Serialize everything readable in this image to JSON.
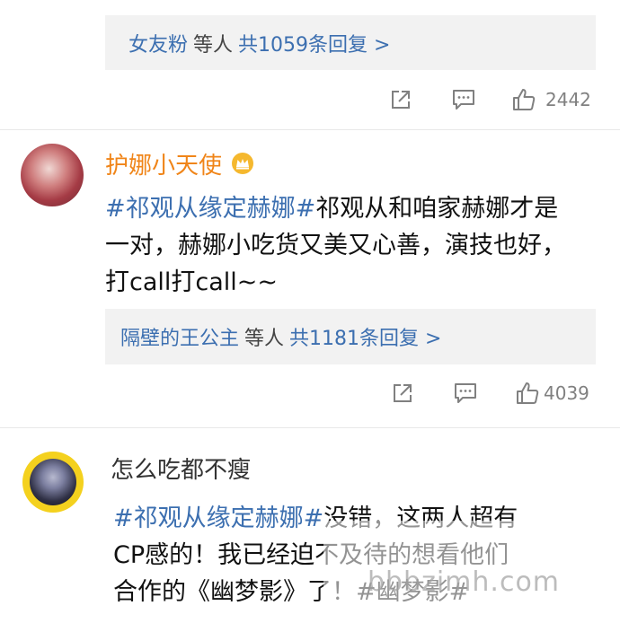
{
  "comment1": {
    "reply_summary": {
      "names": "女友粉",
      "suffix": "等人",
      "count_link": "共1059条回复 >"
    },
    "actions": {
      "like_count": "2442"
    }
  },
  "comment2": {
    "username": "护娜小天使",
    "hashtag": "#祁观从缘定赫娜#",
    "text": "祁观从和咱家赫娜才是一对，赫娜小吃货又美又心善，演技也好，打call打call~~",
    "reply_summary": {
      "names": "隔壁的王公主",
      "suffix": "等人",
      "count_link": "共1181条回复 >"
    },
    "actions": {
      "like_count": "4039"
    }
  },
  "comment3": {
    "username": "怎么吃都不瘦",
    "hashtag": "#祁观从缘定赫娜#",
    "text_line1": "没错，这两人超有",
    "text_line2": "CP感的！我已经迫不及待的想看他们",
    "text_line3": "合作的《幽梦影》了！#幽梦影#"
  },
  "watermark": "bbbzimh.com",
  "colors": {
    "link": "#3c6fb0",
    "username_vip": "#f08519",
    "meta_gray": "#808080",
    "reply_bg": "#f2f2f2"
  }
}
